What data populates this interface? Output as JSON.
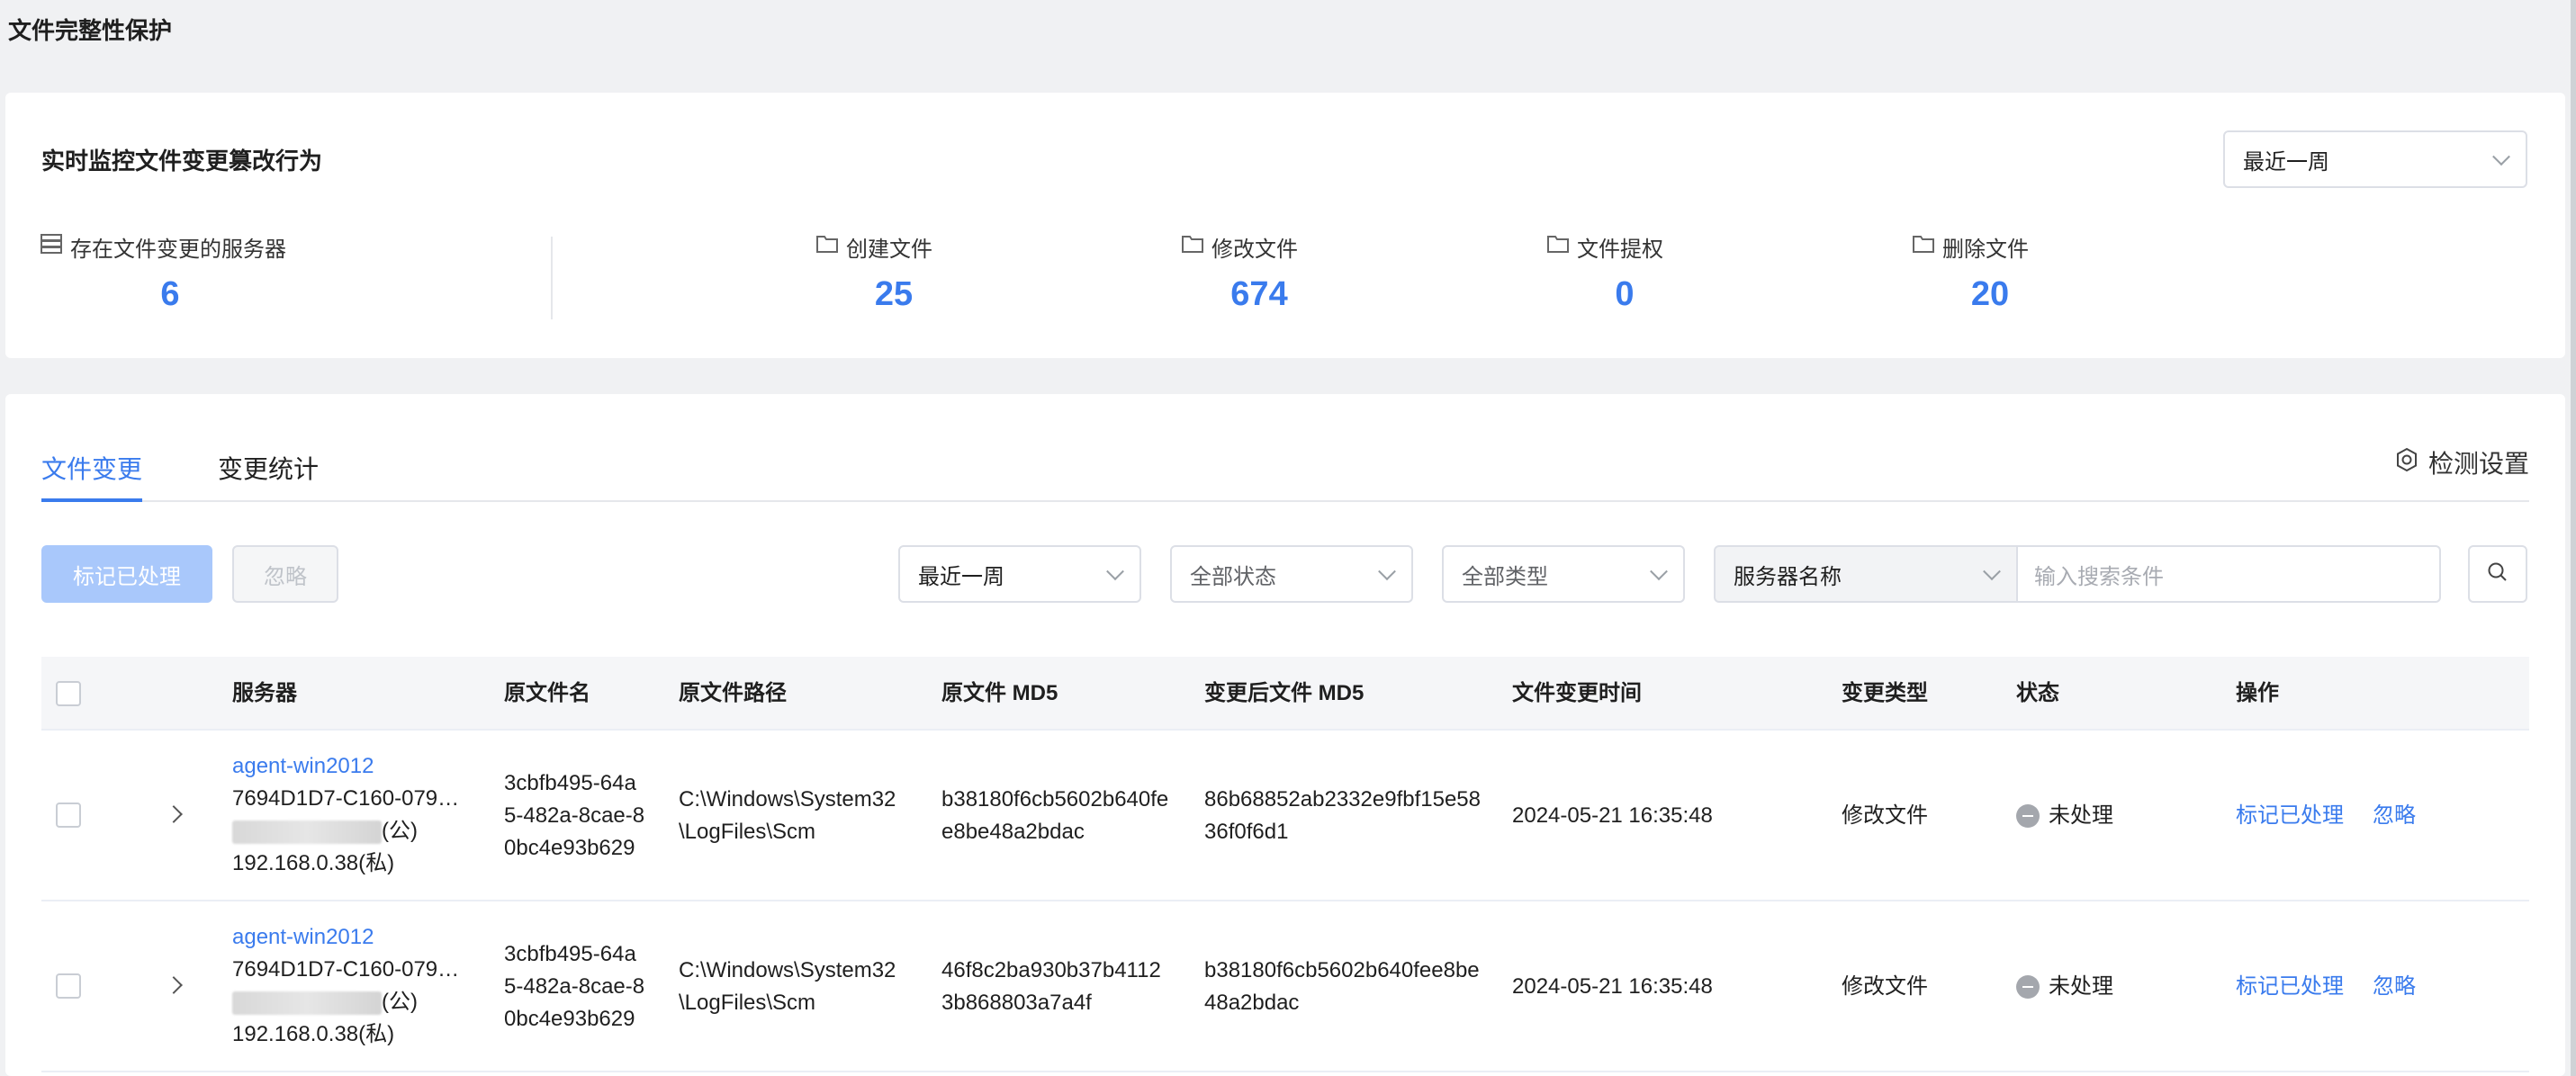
{
  "page": {
    "title": "文件完整性保护"
  },
  "summary": {
    "title": "实时监控文件变更篡改行为",
    "range_select": "最近一周",
    "stats": [
      {
        "label": "存在文件变更的服务器",
        "value": "6",
        "icon": "server-icon"
      },
      {
        "label": "创建文件",
        "value": "25",
        "icon": "folder-icon"
      },
      {
        "label": "修改文件",
        "value": "674",
        "icon": "folder-icon"
      },
      {
        "label": "文件提权",
        "value": "0",
        "icon": "folder-icon"
      },
      {
        "label": "删除文件",
        "value": "20",
        "icon": "folder-icon"
      }
    ],
    "accent_color": "#3a7bed"
  },
  "tabs": [
    {
      "label": "文件变更",
      "active": true
    },
    {
      "label": "变更统计",
      "active": false
    }
  ],
  "settings_label": "检测设置",
  "toolbar": {
    "mark_label": "标记已处理",
    "ignore_label": "忽略",
    "range_filter": "最近一周",
    "status_filter": "全部状态",
    "type_filter": "全部类型",
    "search_field_select": "服务器名称",
    "search_placeholder": "输入搜索条件"
  },
  "table": {
    "columns": [
      "服务器",
      "原文件名",
      "原文件路径",
      "原文件 MD5",
      "变更后文件 MD5",
      "文件变更时间",
      "变更类型",
      "状态",
      "操作"
    ],
    "rows": [
      {
        "server_name": "agent-win2012",
        "server_id": "7694D1D7-C160-079…",
        "public_ip_suffix": "(公)",
        "private_ip": "192.168.0.38(私)",
        "file_name": [
          "3cbfb495-64a",
          "5-482a-8cae-8",
          "0bc4e93b629"
        ],
        "file_path": [
          "C:\\Windows\\System32",
          "\\LogFiles\\Scm"
        ],
        "orig_md5": [
          "b38180f6cb5602b640fe",
          "e8be48a2bdac"
        ],
        "new_md5": [
          "86b68852ab2332e9fbf15e58",
          "36f0f6d1"
        ],
        "change_time": "2024-05-21 16:35:48",
        "change_type": "修改文件",
        "status": "未处理",
        "action_mark": "标记已处理",
        "action_ignore": "忽略"
      },
      {
        "server_name": "agent-win2012",
        "server_id": "7694D1D7-C160-079…",
        "public_ip_suffix": "(公)",
        "private_ip": "192.168.0.38(私)",
        "file_name": [
          "3cbfb495-64a",
          "5-482a-8cae-8",
          "0bc4e93b629"
        ],
        "file_path": [
          "C:\\Windows\\System32",
          "\\LogFiles\\Scm"
        ],
        "orig_md5": [
          "46f8c2ba930b37b4112",
          "3b868803a7a4f"
        ],
        "new_md5": [
          "b38180f6cb5602b640fee8be",
          "48a2bdac"
        ],
        "change_time": "2024-05-21 16:35:48",
        "change_type": "修改文件",
        "status": "未处理",
        "action_mark": "标记已处理",
        "action_ignore": "忽略"
      }
    ]
  }
}
